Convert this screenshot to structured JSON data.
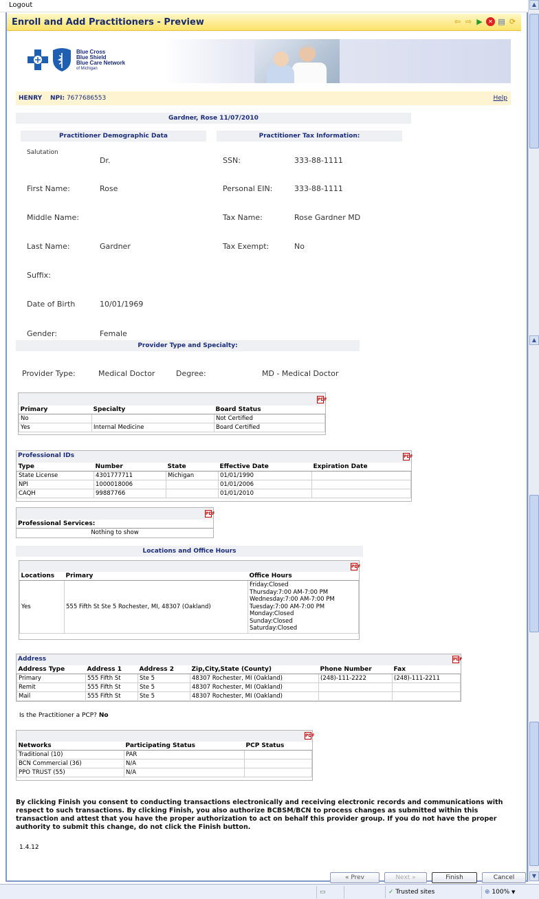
{
  "top": {
    "logout": "Logout"
  },
  "window": {
    "title": "Enroll and Add Practitioners - Preview"
  },
  "banner": {
    "line1": "Blue Cross",
    "line2": "Blue Shield",
    "line3": "Blue Care Network",
    "line4": "of Michigan"
  },
  "infobar": {
    "name": "HENRY",
    "npi_label": "NPI:",
    "npi_value": "7677686553",
    "help": "Help"
  },
  "record_title": "Gardner, Rose 11/07/2010",
  "demographics": {
    "heading": "Practitioner Demographic Data",
    "salutation_label": "Salutation",
    "salutation": "Dr.",
    "first_name_label": "First Name:",
    "first_name": "Rose",
    "middle_name_label": "Middle Name:",
    "middle_name": "",
    "last_name_label": "Last Name:",
    "last_name": "Gardner",
    "suffix_label": "Suffix:",
    "suffix": "",
    "dob_label": "Date of Birth",
    "dob": "10/01/1969",
    "gender_label": "Gender:",
    "gender": "Female"
  },
  "tax": {
    "heading": "Practitioner Tax Information:",
    "ssn_label": "SSN:",
    "ssn": "333-88-1111",
    "ein_label": "Personal EIN:",
    "ein": "333-88-1111",
    "tax_name_label": "Tax Name:",
    "tax_name": "Rose Gardner MD",
    "tax_exempt_label": "Tax Exempt:",
    "tax_exempt": "No"
  },
  "provider_type": {
    "heading": "Provider Type and Specialty:",
    "type_label": "Provider Type:",
    "type": "Medical Doctor",
    "degree_label": "Degree:",
    "degree": "MD - Medical Doctor"
  },
  "specialty_table": {
    "headers": [
      "Primary",
      "Specialty",
      "Board Status"
    ],
    "rows": [
      [
        "No",
        "",
        "Not Certified"
      ],
      [
        "Yes",
        "Internal Medicine",
        "Board Certified"
      ]
    ]
  },
  "professional_ids": {
    "title": "Professional IDs",
    "headers": [
      "Type",
      "Number",
      "State",
      "Effective Date",
      "Expiration Date"
    ],
    "rows": [
      [
        "State License",
        "4301777711",
        "Michigan",
        "01/01/1990",
        ""
      ],
      [
        "NPI",
        "1000018006",
        "",
        "01/01/2006",
        ""
      ],
      [
        "CAQH",
        "99887766",
        "",
        "01/01/2010",
        ""
      ]
    ]
  },
  "professional_services": {
    "title": "Professional Services:",
    "empty": "Nothing to show"
  },
  "locations": {
    "heading": "Locations and Office Hours",
    "headers": [
      "Locations",
      "Primary",
      "Office Hours"
    ],
    "row": {
      "location": "Yes",
      "primary": "555 Fifth St Ste 5 Rochester, MI, 48307 (Oakland)",
      "hours": [
        "Friday:Closed",
        "Thursday:7:00 AM-7:00 PM",
        "Wednesday:7:00 AM-7:00 PM",
        "Tuesday:7:00 AM-7:00 PM",
        "Monday:Closed",
        "Sunday:Closed",
        "Saturday:Closed"
      ]
    }
  },
  "address": {
    "title": "Address",
    "headers": [
      "Address Type",
      "Address 1",
      "Address 2",
      "Zip,City,State (County)",
      "Phone Number",
      "Fax"
    ],
    "rows": [
      [
        "Primary",
        "555 Fifth St",
        "Ste 5",
        "48307 Rochester, MI (Oakland)",
        "(248)-111-2222",
        "(248)-111-2211"
      ],
      [
        "Remit",
        "555 Fifth St",
        "Ste 5",
        "48307 Rochester, MI (Oakland)",
        "",
        ""
      ],
      [
        "Mail",
        "555 Fifth St",
        "Ste 5",
        "48307 Rochester, MI (Oakland)",
        "",
        ""
      ]
    ]
  },
  "pcp": {
    "question": "Is the Practitioner a PCP?",
    "answer": "No"
  },
  "networks": {
    "headers": [
      "Networks",
      "Participating Status",
      "PCP Status"
    ],
    "rows": [
      [
        "Traditional (10)",
        "PAR",
        ""
      ],
      [
        "BCN Commercial (36)",
        "N/A",
        ""
      ],
      [
        "PPO TRUST (55)",
        "N/A",
        ""
      ]
    ]
  },
  "consent": "By clicking Finish you consent to conducting transactions electronically and receiving electronic records and communications with respect to such transactions. By clicking Finish, you also authorize BCBSM/BCN to process changes as submitted within this transaction and attest that you have the proper authorization to act on behalf this provider group. If you do not have the proper authority to submit this change, do not click the Finish button.",
  "version": "1.4.12",
  "buttons": {
    "prev": "« Prev",
    "next": "Next »",
    "finish": "Finish",
    "cancel": "Cancel"
  },
  "status": {
    "zone": "Trusted sites",
    "zoom": "100%"
  },
  "icons": [
    "back-arrow-icon",
    "forward-arrow-icon",
    "play-icon",
    "close-icon",
    "print-icon",
    "refresh-icon",
    "pdf-icon",
    "check-icon"
  ]
}
